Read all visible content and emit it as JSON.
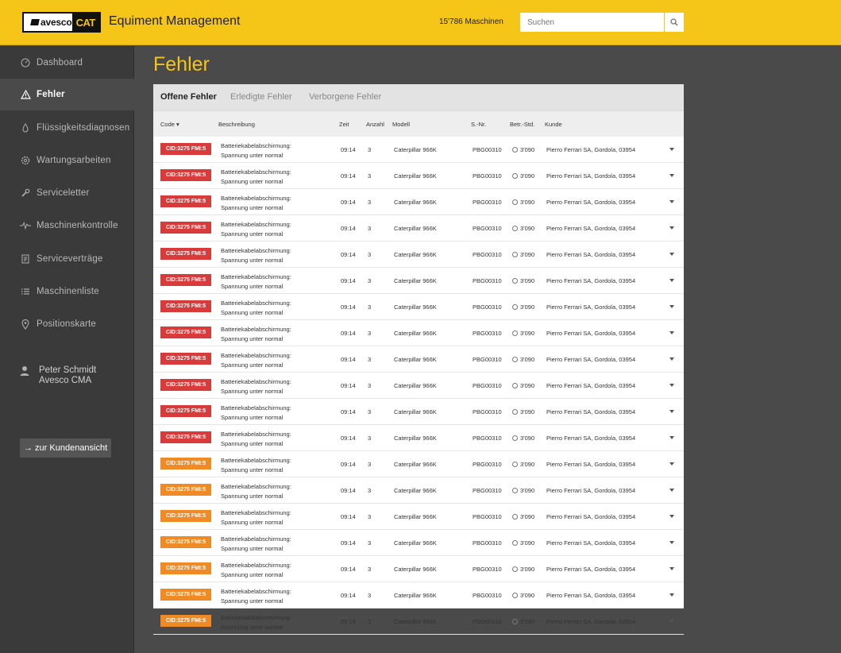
{
  "header": {
    "logo_avesco": "avesco",
    "logo_cat": "CAT",
    "app_title": "Equiment Management",
    "machine_count": "15'786 Maschinen",
    "search_placeholder": "Suchen"
  },
  "sidebar": {
    "items": [
      {
        "label": "Dashboard",
        "icon": "dashboard-icon",
        "active": false
      },
      {
        "label": "Fehler",
        "icon": "warning-icon",
        "active": true
      },
      {
        "label": "Flüssigkeitsdiagnosen",
        "icon": "drop-icon",
        "active": false
      },
      {
        "label": "Wartungsarbeiten",
        "icon": "gear-icon",
        "active": false
      },
      {
        "label": "Serviceletter",
        "icon": "wrench-icon",
        "active": false
      },
      {
        "label": "Maschinenkontrolle",
        "icon": "pulse-icon",
        "active": false
      },
      {
        "label": "Serviceverträge",
        "icon": "contract-icon",
        "active": false
      },
      {
        "label": "Maschinenliste",
        "icon": "list-icon",
        "active": false
      },
      {
        "label": "Positionskarte",
        "icon": "map-pin-icon",
        "active": false
      }
    ],
    "user_name": "Peter Schmidt",
    "user_company": "Avesco CMA",
    "customer_view": "→ zur Kundenansicht"
  },
  "main": {
    "title": "Fehler",
    "tabs": [
      {
        "label": "Offene Fehler",
        "active": true
      },
      {
        "label": "Erledigte Fehler",
        "active": false
      },
      {
        "label": "Verborgene Fehler",
        "active": false
      }
    ],
    "columns": {
      "code": "Code",
      "description": "Beschreibung",
      "time": "Zeit",
      "count": "Anzahl",
      "model": "Modell",
      "serial": "S.-Nr.",
      "hours": "Betr.-Std.",
      "customer": "Kunde"
    },
    "rows": [
      {
        "code": "CID:3275 FMI:5",
        "severity": "red",
        "desc1": "Batteriekabelabschirmung:",
        "desc2": "Spannung unter normal",
        "time": "09:14",
        "count": "3",
        "model": "Caterpillar 966K",
        "serial": "PBG00310",
        "hours": "3'090",
        "customer": "Pierro Ferrari SA, Gordola, 03954"
      },
      {
        "code": "CID:3275 FMI:5",
        "severity": "red",
        "desc1": "Batteriekabelabschirmung:",
        "desc2": "Spannung unter normal",
        "time": "09:14",
        "count": "3",
        "model": "Caterpillar 966K",
        "serial": "PBG00310",
        "hours": "3'090",
        "customer": "Pierro Ferrari SA, Gordola, 03954"
      },
      {
        "code": "CID:3275 FMI:5",
        "severity": "red",
        "desc1": "Batteriekabelabschirmung:",
        "desc2": "Spannung unter normal",
        "time": "09:14",
        "count": "3",
        "model": "Caterpillar 966K",
        "serial": "PBG00310",
        "hours": "3'090",
        "customer": "Pierro Ferrari SA, Gordola, 03954"
      },
      {
        "code": "CID:3275 FMI:5",
        "severity": "red",
        "desc1": "Batteriekabelabschirmung:",
        "desc2": "Spannung unter normal",
        "time": "09:14",
        "count": "3",
        "model": "Caterpillar 966K",
        "serial": "PBG00310",
        "hours": "3'090",
        "customer": "Pierro Ferrari SA, Gordola, 03954"
      },
      {
        "code": "CID:3275 FMI:5",
        "severity": "red",
        "desc1": "Batteriekabelabschirmung:",
        "desc2": "Spannung unter normal",
        "time": "09:14",
        "count": "3",
        "model": "Caterpillar 966K",
        "serial": "PBG00310",
        "hours": "3'090",
        "customer": "Pierro Ferrari SA, Gordola, 03954"
      },
      {
        "code": "CID:3275 FMI:5",
        "severity": "red",
        "desc1": "Batteriekabelabschirmung:",
        "desc2": "Spannung unter normal",
        "time": "09:14",
        "count": "3",
        "model": "Caterpillar 966K",
        "serial": "PBG00310",
        "hours": "3'090",
        "customer": "Pierro Ferrari SA, Gordola, 03954"
      },
      {
        "code": "CID:3275 FMI:5",
        "severity": "red",
        "desc1": "Batteriekabelabschirmung:",
        "desc2": "Spannung unter normal",
        "time": "09:14",
        "count": "3",
        "model": "Caterpillar 966K",
        "serial": "PBG00310",
        "hours": "3'090",
        "customer": "Pierro Ferrari SA, Gordola, 03954"
      },
      {
        "code": "CID:3275 FMI:5",
        "severity": "red",
        "desc1": "Batteriekabelabschirmung:",
        "desc2": "Spannung unter normal",
        "time": "09:14",
        "count": "3",
        "model": "Caterpillar 966K",
        "serial": "PBG00310",
        "hours": "3'090",
        "customer": "Pierro Ferrari SA, Gordola, 03954"
      },
      {
        "code": "CID:3275 FMI:5",
        "severity": "red",
        "desc1": "Batteriekabelabschirmung:",
        "desc2": "Spannung unter normal",
        "time": "09:14",
        "count": "3",
        "model": "Caterpillar 966K",
        "serial": "PBG00310",
        "hours": "3'090",
        "customer": "Pierro Ferrari SA, Gordola, 03954"
      },
      {
        "code": "CID:3275 FMI:5",
        "severity": "red",
        "desc1": "Batteriekabelabschirmung:",
        "desc2": "Spannung unter normal",
        "time": "09:14",
        "count": "3",
        "model": "Caterpillar 966K",
        "serial": "PBG00310",
        "hours": "3'090",
        "customer": "Pierro Ferrari SA, Gordola, 03954"
      },
      {
        "code": "CID:3275 FMI:5",
        "severity": "red",
        "desc1": "Batteriekabelabschirmung:",
        "desc2": "Spannung unter normal",
        "time": "09:14",
        "count": "3",
        "model": "Caterpillar 966K",
        "serial": "PBG00310",
        "hours": "3'090",
        "customer": "Pierro Ferrari SA, Gordola, 03954"
      },
      {
        "code": "CID:3275 FMI:5",
        "severity": "red",
        "desc1": "Batteriekabelabschirmung:",
        "desc2": "Spannung unter normal",
        "time": "09:14",
        "count": "3",
        "model": "Caterpillar 966K",
        "serial": "PBG00310",
        "hours": "3'090",
        "customer": "Pierro Ferrari SA, Gordola, 03954"
      },
      {
        "code": "CID:3275 FMI:5",
        "severity": "orange",
        "desc1": "Batteriekabelabschirmung:",
        "desc2": "Spannung unter normal",
        "time": "09:14",
        "count": "3",
        "model": "Caterpillar 966K",
        "serial": "PBG00310",
        "hours": "3'090",
        "customer": "Pierro Ferrari SA, Gordola, 03954"
      },
      {
        "code": "CID:3275 FMI:5",
        "severity": "orange",
        "desc1": "Batteriekabelabschirmung:",
        "desc2": "Spannung unter normal",
        "time": "09:14",
        "count": "3",
        "model": "Caterpillar 966K",
        "serial": "PBG00310",
        "hours": "3'090",
        "customer": "Pierro Ferrari SA, Gordola, 03954"
      },
      {
        "code": "CID:3275 FMI:5",
        "severity": "orange",
        "desc1": "Batteriekabelabschirmung:",
        "desc2": "Spannung unter normal",
        "time": "09:14",
        "count": "3",
        "model": "Caterpillar 966K",
        "serial": "PBG00310",
        "hours": "3'090",
        "customer": "Pierro Ferrari SA, Gordola, 03954"
      },
      {
        "code": "CID:3275 FMI:5",
        "severity": "orange",
        "desc1": "Batteriekabelabschirmung:",
        "desc2": "Spannung unter normal",
        "time": "09:14",
        "count": "3",
        "model": "Caterpillar 966K",
        "serial": "PBG00310",
        "hours": "3'090",
        "customer": "Pierro Ferrari SA, Gordola, 03954"
      },
      {
        "code": "CID:3275 FMI:5",
        "severity": "orange",
        "desc1": "Batteriekabelabschirmung:",
        "desc2": "Spannung unter normal",
        "time": "09:14",
        "count": "3",
        "model": "Caterpillar 966K",
        "serial": "PBG00310",
        "hours": "3'090",
        "customer": "Pierro Ferrari SA, Gordola, 03954"
      },
      {
        "code": "CID:3275 FMI:5",
        "severity": "orange",
        "desc1": "Batteriekabelabschirmung:",
        "desc2": "Spannung unter normal",
        "time": "09:14",
        "count": "3",
        "model": "Caterpillar 966K",
        "serial": "PBG00310",
        "hours": "3'090",
        "customer": "Pierro Ferrari SA, Gordola, 03954"
      },
      {
        "code": "CID:3275 FMI:5",
        "severity": "orange",
        "desc1": "Batteriekabelabschirmung:",
        "desc2": "Spannung unter normal",
        "time": "09:14",
        "count": "3",
        "model": "Caterpillar 966K",
        "serial": "PBG00310",
        "hours": "3'090",
        "customer": "Pierro Ferrari SA, Gordola, 03954"
      }
    ]
  },
  "colors": {
    "brand_yellow": "#f5c518",
    "severity_red": "#d93a3a",
    "severity_orange": "#f08a24"
  }
}
